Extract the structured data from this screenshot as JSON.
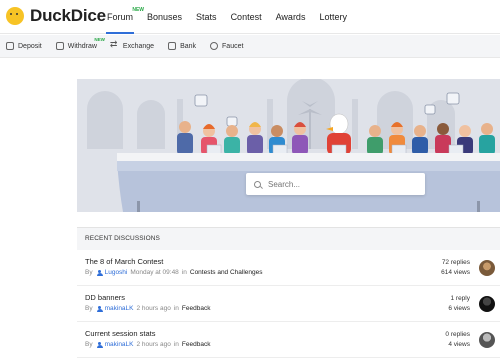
{
  "brand": {
    "name": "DuckDice"
  },
  "nav": {
    "items": [
      {
        "label": "Forum",
        "badge": "NEW",
        "active": true
      },
      {
        "label": "Bonuses"
      },
      {
        "label": "Stats"
      },
      {
        "label": "Contest"
      },
      {
        "label": "Awards"
      },
      {
        "label": "Lottery"
      }
    ]
  },
  "subnav": {
    "items": [
      {
        "label": "Deposit"
      },
      {
        "label": "Withdraw",
        "badge": "NEW"
      },
      {
        "label": "Exchange"
      },
      {
        "label": "Bank"
      },
      {
        "label": "Faucet"
      }
    ]
  },
  "search": {
    "placeholder": "Search..."
  },
  "discussions": {
    "heading": "RECENT DISCUSSIONS",
    "rows": [
      {
        "title": "The 8 of March Contest",
        "by": "By",
        "user": "Lugoshi",
        "time": "Monday at 09:48",
        "in": "in",
        "category": "Contests and Challenges",
        "replies": "72 replies",
        "views": "614 views"
      },
      {
        "title": "DD banners",
        "by": "By",
        "user": "makinaLK",
        "time": "2 hours ago",
        "in": "in",
        "category": "Feedback",
        "replies": "1 reply",
        "views": "6 views"
      },
      {
        "title": "Current session stats",
        "by": "By",
        "user": "makinaLK",
        "time": "2 hours ago",
        "in": "in",
        "category": "Feedback",
        "replies": "0 replies",
        "views": "4 views"
      }
    ]
  },
  "colors": {
    "accent": "#2f6ed8",
    "new_badge": "#27a745",
    "logo": "#f7c325"
  }
}
